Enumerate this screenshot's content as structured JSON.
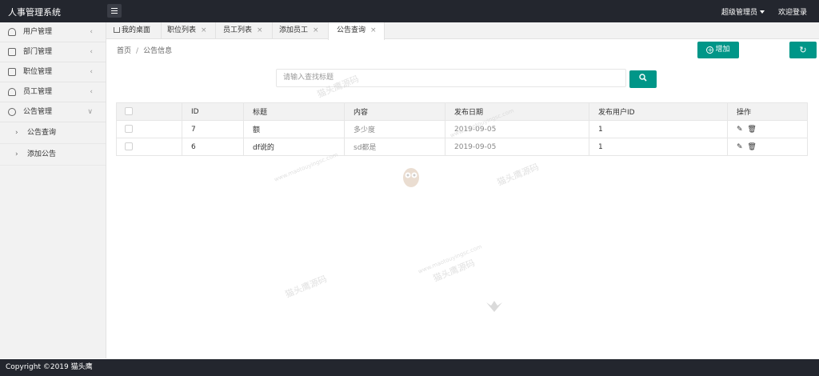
{
  "header": {
    "app_title": "人事管理系统",
    "admin_label": "超级管理员",
    "welcome_label": "欢迎登录"
  },
  "sidebar": {
    "items": [
      {
        "label": "用户管理",
        "arrow": "‹"
      },
      {
        "label": "部门管理",
        "arrow": "‹"
      },
      {
        "label": "职位管理",
        "arrow": "‹"
      },
      {
        "label": "员工管理",
        "arrow": "‹"
      },
      {
        "label": "公告管理",
        "arrow": "∨"
      }
    ],
    "subitems": [
      {
        "label": "公告查询"
      },
      {
        "label": "添加公告"
      }
    ]
  },
  "tabs": [
    {
      "label": "我的桌面",
      "close": ""
    },
    {
      "label": "职位列表",
      "close": "×"
    },
    {
      "label": "员工列表",
      "close": "×"
    },
    {
      "label": "添加员工",
      "close": "×"
    },
    {
      "label": "公告查询",
      "close": "×"
    }
  ],
  "breadcrumb": {
    "home": "首页",
    "sep": "/",
    "current": "公告信息"
  },
  "toolbar": {
    "add_label": "增加"
  },
  "search": {
    "placeholder": "请输入查找标题"
  },
  "table": {
    "headers": [
      "ID",
      "标题",
      "内容",
      "发布日期",
      "发布用户ID",
      "操作"
    ],
    "rows": [
      {
        "id": "7",
        "title": "额",
        "content": "多少度",
        "date": "2019-09-05",
        "user_id": "1"
      },
      {
        "id": "6",
        "title": "df说的",
        "content": "sd都是",
        "date": "2019-09-05",
        "user_id": "1"
      }
    ]
  },
  "footer": {
    "copyright": "Copyright ©2019 猫头鹰"
  },
  "watermark": {
    "text": "猫头鹰源码",
    "url": "www.maotouyingsc.com"
  },
  "colors": {
    "primary": "#009688",
    "header_bg": "#23262e",
    "sidebar_bg": "#f2f2f2"
  }
}
